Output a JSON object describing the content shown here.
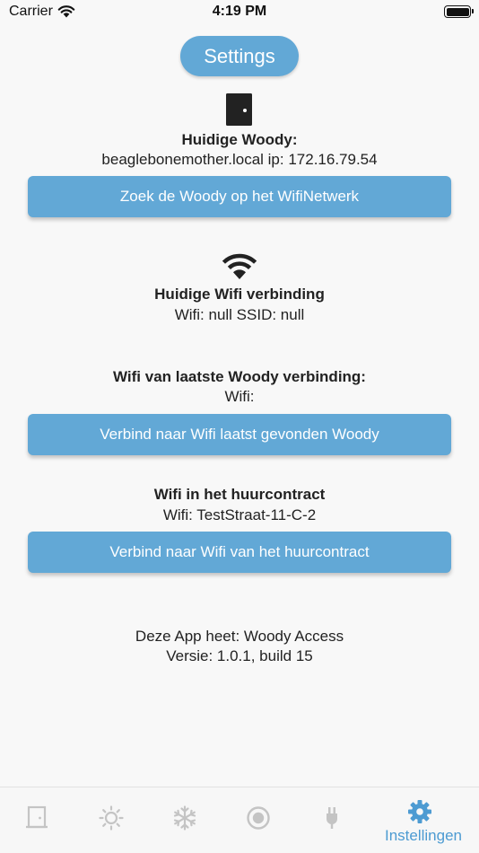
{
  "status_bar": {
    "carrier": "Carrier",
    "time": "4:19 PM",
    "icons": [
      "wifi-icon",
      "battery-icon"
    ]
  },
  "header": {
    "title": "Settings"
  },
  "woody": {
    "icon": "door-icon",
    "heading": "Huidige Woody:",
    "value": "beaglebonemother.local ip: 172.16.79.54",
    "button": "Zoek de Woody op het WifiNetwerk"
  },
  "current_wifi": {
    "icon": "wifi-icon",
    "heading": "Huidige Wifi verbinding",
    "value": "Wifi: null SSID: null"
  },
  "last_woody_wifi": {
    "heading": "Wifi van laatste Woody verbinding:",
    "value": "Wifi:",
    "button": "Verbind naar Wifi laatst gevonden Woody"
  },
  "contract_wifi": {
    "heading": "Wifi in het huurcontract",
    "value": "Wifi: TestStraat-11-C-2",
    "button": "Verbind naar Wifi van het huurcontract"
  },
  "app_info": {
    "name_line": "Deze App heet: Woody Access",
    "version_line": "Versie:  1.0.1, build 15"
  },
  "tab_bar": {
    "tabs": [
      {
        "icon": "door-icon",
        "active": false
      },
      {
        "icon": "sun-icon",
        "active": false
      },
      {
        "icon": "snowflake-icon",
        "active": false
      },
      {
        "icon": "record-icon",
        "active": false
      },
      {
        "icon": "plug-icon",
        "active": false
      },
      {
        "icon": "gear-icon",
        "label": "Instellingen",
        "active": true
      }
    ],
    "active_color": "#4d9bd2",
    "inactive_color": "#c4c4c4"
  },
  "colors": {
    "accent": "#62a8d6",
    "background": "#f8f8f8"
  }
}
